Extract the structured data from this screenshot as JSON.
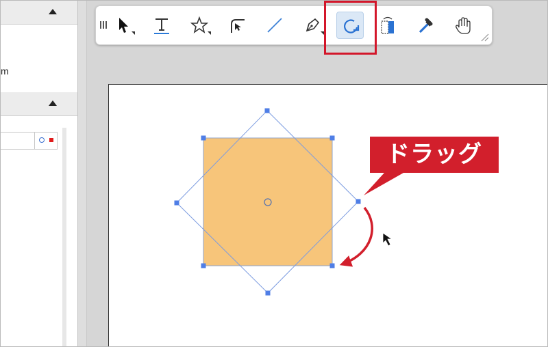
{
  "left_panel": {
    "partial_text": "m"
  },
  "toolbar": {
    "tools": [
      {
        "name": "selection-tool",
        "icon": "arrow-cursor-icon"
      },
      {
        "name": "text-tool",
        "icon": "text-T-icon"
      },
      {
        "name": "shape-tool",
        "icon": "star-icon"
      },
      {
        "name": "corner-tool",
        "icon": "corner-arrow-icon"
      },
      {
        "name": "line-tool",
        "icon": "line-icon"
      },
      {
        "name": "pen-tool",
        "icon": "pen-nib-icon"
      },
      {
        "name": "rotate-tool",
        "icon": "rotate-icon",
        "selected": true
      },
      {
        "name": "transform-tool",
        "icon": "transform-icon"
      },
      {
        "name": "eyedropper-tool",
        "icon": "eyedropper-icon"
      },
      {
        "name": "hand-tool",
        "icon": "hand-icon"
      }
    ]
  },
  "annotation": {
    "callout_text": "ドラッグ",
    "accent_color": "#d21f2c"
  },
  "canvas": {
    "shape_fill": "#f7c57a",
    "selection_color": "#5b84e0"
  }
}
